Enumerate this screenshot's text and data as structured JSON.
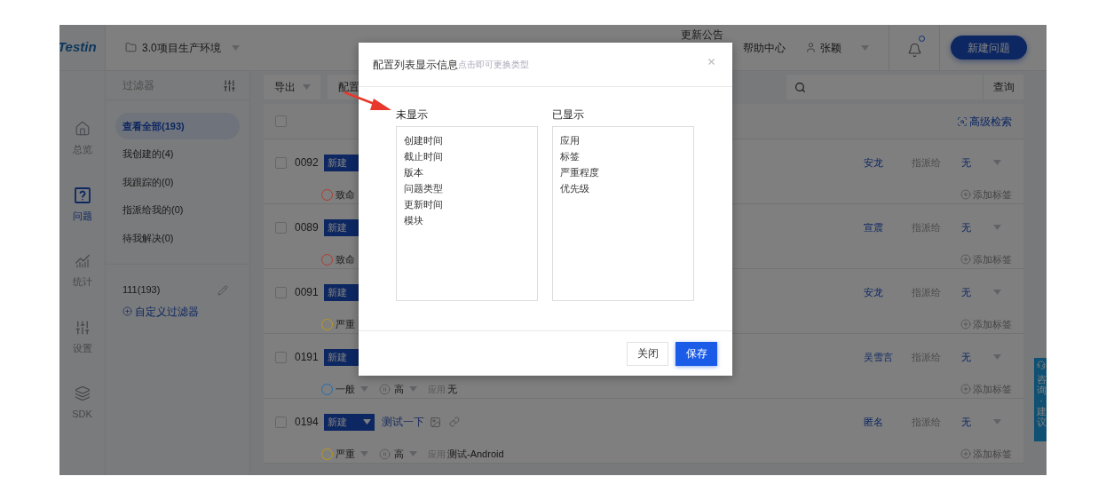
{
  "app": {
    "logo": "Testin",
    "nav": [
      {
        "label": "总览",
        "selected": false
      },
      {
        "label": "问题",
        "selected": true
      },
      {
        "label": "统计",
        "selected": false
      },
      {
        "label": "设置",
        "selected": false
      },
      {
        "label": "SDK",
        "selected": false
      }
    ]
  },
  "topbar": {
    "project": "3.0项目生产环境",
    "links": [
      "更新公告",
      "帮助中心"
    ],
    "user": "张颖",
    "notification_dot": true,
    "new_button": "新建问题"
  },
  "filters": {
    "title": "过滤器",
    "items": [
      {
        "label": "查看全部(193)",
        "selected": true
      },
      {
        "label": "我创建的(4)",
        "selected": false
      },
      {
        "label": "我跟踪的(0)",
        "selected": false
      },
      {
        "label": "指派给我的(0)",
        "selected": false
      },
      {
        "label": "待我解决(0)",
        "selected": false
      }
    ],
    "custom": [
      {
        "label": "111(193)"
      }
    ],
    "add_custom": "自定义过滤器"
  },
  "toolbar": {
    "export": "导出",
    "config": "配置",
    "search_button": "查询"
  },
  "list": {
    "select_all_checked": false,
    "advanced_search": "高级检索",
    "rows": [
      {
        "id": "0092",
        "checked": false,
        "status": "新建",
        "severity": {
          "label": "致命",
          "color": "#b23a2e"
        },
        "assignee": "安龙",
        "assign_label": "指派给",
        "assigned_to": "无",
        "add_tag": "添加标签"
      },
      {
        "id": "0089",
        "checked": false,
        "status": "新建",
        "severity": {
          "label": "致命",
          "color": "#b23a2e"
        },
        "assignee": "宣震",
        "assign_label": "指派给",
        "assigned_to": "无",
        "add_tag": "添加标签"
      },
      {
        "id": "0091",
        "checked": false,
        "status": "新建",
        "severity": {
          "label": "严重",
          "color": "#c29a10"
        },
        "assignee": "安龙",
        "assign_label": "指派给",
        "assigned_to": "无",
        "add_tag": "添加标签"
      },
      {
        "id": "0191",
        "checked": false,
        "status": "新建",
        "severity": {
          "label": "一般",
          "color": "#1f6db5"
        },
        "priority": "高",
        "app_label": "应用",
        "app": "无",
        "assignee": "吴雪言",
        "assign_label": "指派给",
        "assigned_to": "无",
        "add_tag": "添加标签"
      },
      {
        "id": "0194",
        "checked": false,
        "status": "新建",
        "title": "测试一下",
        "severity": {
          "label": "严重",
          "color": "#c29a10"
        },
        "priority": "高",
        "app_label": "应用",
        "app": "测试-Android",
        "assignee": "匿名",
        "assign_label": "指派给",
        "assigned_to": "无",
        "add_tag": "添加标签"
      }
    ]
  },
  "dialog": {
    "title": "配置列表显示信息",
    "hint": "点击即可更换类型",
    "hidden_label": "未显示",
    "hidden": [
      "创建时间",
      "截止时间",
      "版本",
      "问题类型",
      "更新时间",
      "模块"
    ],
    "shown_label": "已显示",
    "shown": [
      "应用",
      "标签",
      "严重程度",
      "优先级"
    ],
    "buttons": [
      {
        "label": "关闭",
        "kind": "secondary"
      },
      {
        "label": "保存",
        "kind": "primary"
      }
    ]
  },
  "feedback_tab": {
    "text": "咨询·建议"
  }
}
